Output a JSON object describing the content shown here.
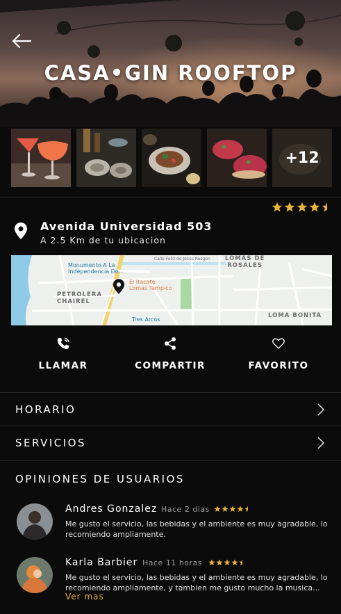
{
  "venue": {
    "title": "CASA•GIN ROOFTOP",
    "rating": 4.5,
    "address": "Avenida Universidad 503",
    "distance": "A 2.5 Km de tu ubicacion"
  },
  "gallery": {
    "more_count": "+12"
  },
  "map": {
    "labels": {
      "lomas_rosales": "LOMAS DE\nROSALES",
      "monumento": "Monumento A La\nIndependencia De...",
      "petrolera": "PETROLERA\nCHAIREL",
      "itacate": "El Itacate\nLomas Tampico",
      "tres_arcos": "Tres Arcos",
      "loma_bonita": "LOMA BONITA",
      "calle": "Calle Feliz de Jesús Rosgon"
    }
  },
  "actions": {
    "call": "LLAMAR",
    "share": "COMPARTIR",
    "favorite": "FAVORITO"
  },
  "sections": {
    "hours": "HORARIO",
    "services": "SERVICIOS",
    "reviews_title": "OPINIONES DE USUARIOS"
  },
  "reviews": [
    {
      "name": "Andres Gonzalez",
      "time": "Hace 2 dias",
      "stars": 4.5,
      "text": "Me gusto el servicio, las bebidas y el ambiente es muy agradable, lo recomiendo ampliamente."
    },
    {
      "name": "Karla Barbier",
      "time": "Hace 11 horas",
      "stars": 4.5,
      "text": "Me gusto el servicio, las bebidas y  el ambiente es muy agradable, lo recomiendo ampliamente, y tambien me gusto mucho la musica..."
    }
  ],
  "see_more": "Ver mas",
  "colors": {
    "background": "#0b0b0b",
    "star": "#e9b33a",
    "accent": "#e9b33a",
    "divider": "#262626"
  }
}
